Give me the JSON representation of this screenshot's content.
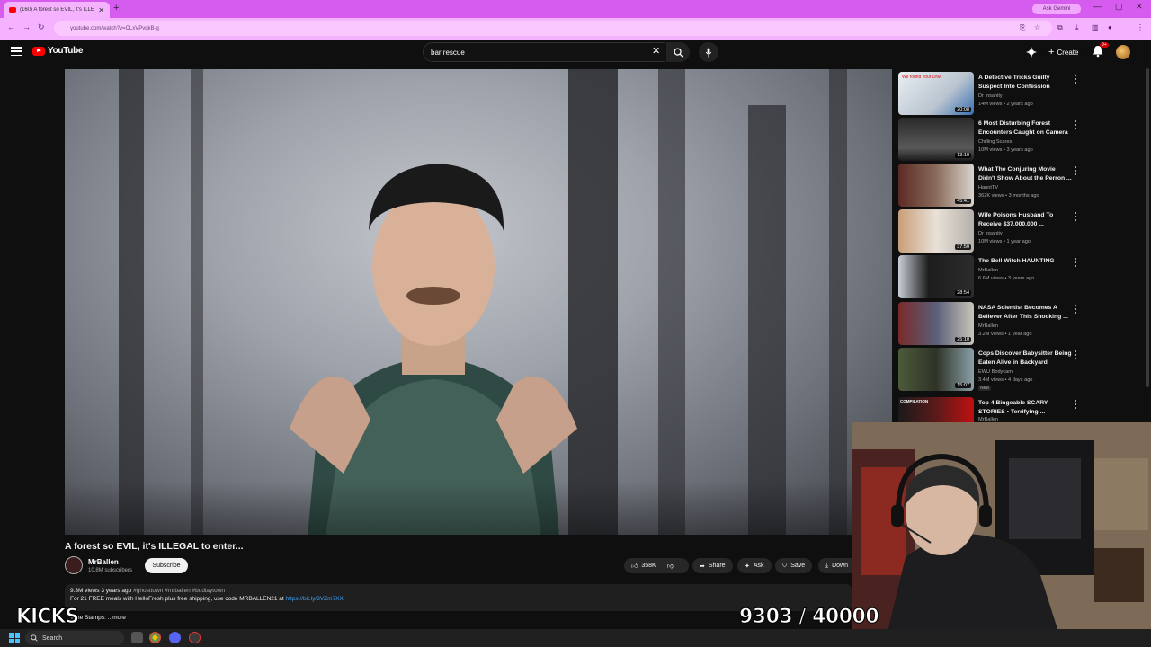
{
  "browser": {
    "tab_title": "(160) A forest so EVIL, it's ILLEGAL...",
    "ask_gemini": "Ask Gemini",
    "url": "youtube.com/watch?v=CLxVPvqkB-g"
  },
  "youtube": {
    "logo_text": "YouTube",
    "search_value": "bar rescue",
    "create_label": "Create",
    "notification_count": "9+"
  },
  "video": {
    "title": "A forest so EVIL, it's ILLEGAL to enter...",
    "channel": "MrBallen",
    "subscribers": "10.8M subscribers",
    "subscribe_label": "Subscribe",
    "likes": "358K",
    "share_label": "Share",
    "ask_label": "Ask",
    "save_label": "Save",
    "download_label": "Down",
    "views_age": "9.3M views  3 years ago",
    "hashtags": "#ghosttown #mrballen #budlaytown",
    "desc_line": "For 21 FREE meals with HelloFresh plus free shipping, use code MRBALLEN21 at",
    "desc_link": "https://bit.ly/3VZm7XX",
    "timestamps": "Time Stamps:  ...more"
  },
  "sidebar": {
    "items": [
      {
        "title": "A Detective Tricks Guilty Suspect Into Confession",
        "channel": "Dr Insanity",
        "meta": "14M views • 2 years ago",
        "duration": "20:08",
        "thumb_text": "We found your DNA"
      },
      {
        "title": "6 Most Disturbing Forest Encounters Caught on Camera",
        "channel": "Chilling Scares",
        "meta": "10M views • 3 years ago",
        "duration": "13:19"
      },
      {
        "title": "What The Conjuring Movie Didn't Show About the Perron ...",
        "channel": "HauntTV",
        "meta": "362K views • 3 months ago",
        "duration": "45:41"
      },
      {
        "title": "Wife Poisons Husband To Receive $37,000,000 ...",
        "channel": "Dr Insanity",
        "meta": "10M views • 1 year ago",
        "duration": "37:50"
      },
      {
        "title": "The Bell Witch HAUNTING",
        "channel": "MrBallen",
        "meta": "6.6M views • 3 years ago",
        "duration": "28:54"
      },
      {
        "title": "NASA Scientist Becomes A Believer After This Shocking ...",
        "channel": "MrBallen",
        "meta": "3.2M views • 1 year ago",
        "duration": "25:10"
      },
      {
        "title": "Cops Discover Babysitter Being Eaten Alive in Backyard",
        "channel": "EWU Bodycam",
        "meta": "3.4M views • 4 days ago",
        "duration": "15:07",
        "badge": "New"
      },
      {
        "title": "Top 4 Bingeable SCARY STORIES • Terrifying ...",
        "channel": "MrBallen",
        "meta": "",
        "duration": "",
        "thumb_text": "COMPILATION"
      }
    ]
  },
  "overlay": {
    "kicks": "KICKS",
    "counter": "9303 / 40000"
  },
  "taskbar": {
    "search_label": "Search"
  }
}
